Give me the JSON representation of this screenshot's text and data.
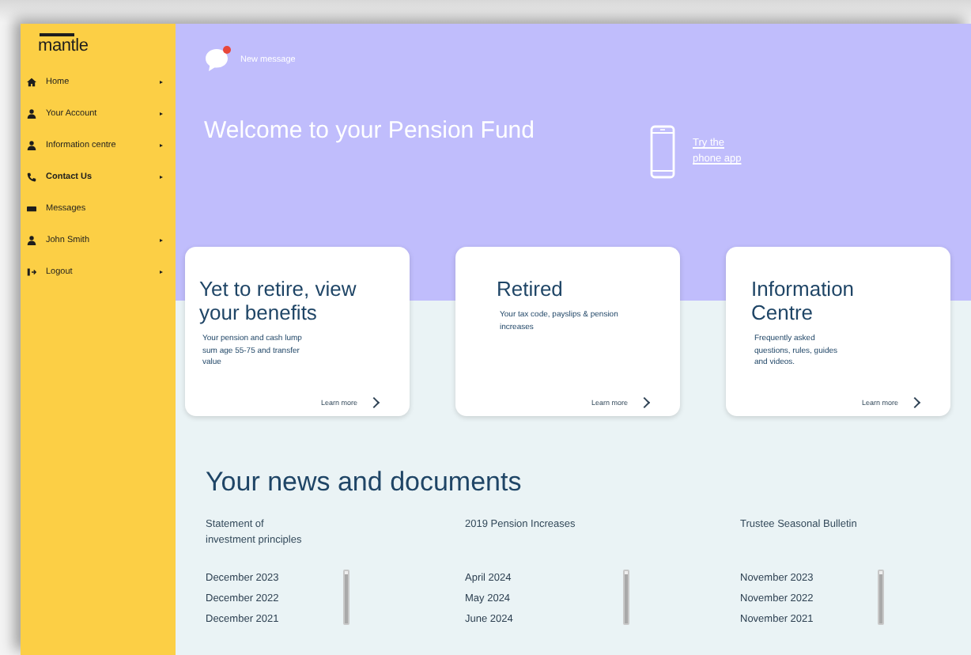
{
  "sidebar": {
    "logo": "mantle",
    "items": [
      {
        "label": "Home",
        "kind": "home",
        "selected": false,
        "has_arrow": true
      },
      {
        "label": "Your Account",
        "kind": "person",
        "selected": false,
        "has_arrow": true
      },
      {
        "label": "Information centre",
        "kind": "person",
        "selected": false,
        "has_arrow": true
      },
      {
        "label": "Contact Us",
        "kind": "phone",
        "selected": true,
        "has_arrow": true
      },
      {
        "label": "Messages",
        "kind": "mail",
        "selected": false,
        "has_arrow": false
      },
      {
        "label": "John Smith",
        "kind": "person",
        "selected": false,
        "has_arrow": true
      },
      {
        "label": "Logout",
        "kind": "logout",
        "selected": false,
        "has_arrow": true
      }
    ]
  },
  "header": {
    "notification": {
      "label": "New message",
      "unread": true
    },
    "title": "Welcome to your Pension Fund",
    "app_link": [
      "Try the",
      "phone app"
    ]
  },
  "cards": [
    {
      "title": "Yet to retire, view your benefits",
      "description": "Your pension and cash lump sum age 55-75 and transfer value",
      "link": "Learn more"
    },
    {
      "title": "Retired",
      "description": "Your tax code, payslips & pension increases",
      "link": "Learn more"
    },
    {
      "title": "Information Centre",
      "description": "Frequently asked questions, rules, guides and videos.",
      "link": "Learn more"
    }
  ],
  "news": {
    "title": "Your news and documents",
    "columns": [
      {
        "heading": "Statement of investment principles",
        "items": [
          "December 2023",
          "December 2022",
          "December 2021"
        ]
      },
      {
        "heading": "2019 Pension Increases",
        "items": [
          "April 2024",
          "May 2024",
          "June 2024"
        ]
      },
      {
        "heading": "Trustee Seasonal Bulletin",
        "items": [
          "November 2023",
          "November 2022",
          "November 2021"
        ]
      }
    ]
  }
}
